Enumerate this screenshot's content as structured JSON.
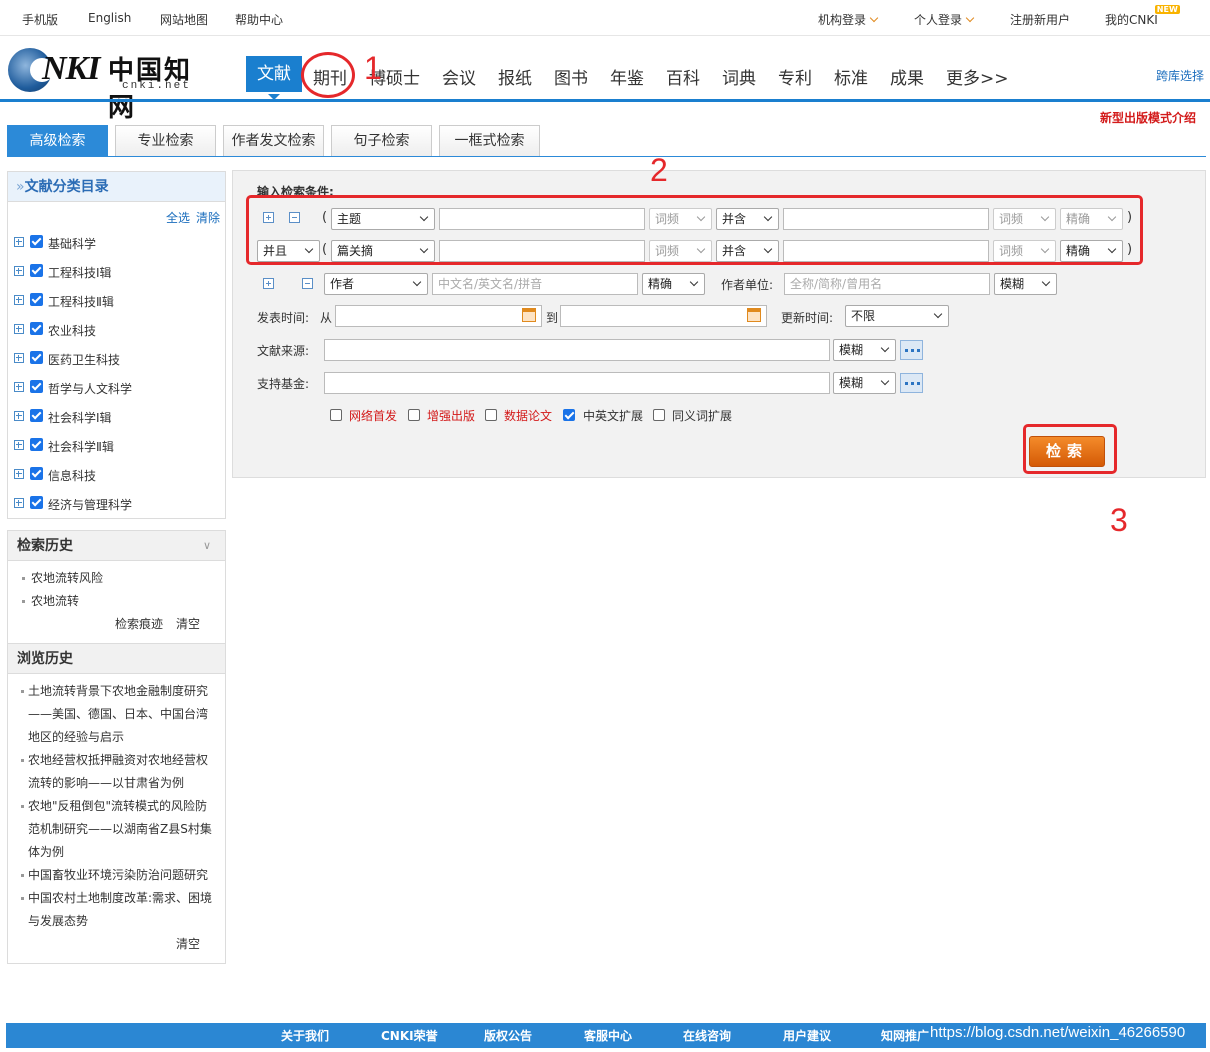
{
  "topbar": {
    "mobile": "手机版",
    "english": "English",
    "sitemap": "网站地图",
    "help": "帮助中心",
    "org_login": "机构登录",
    "personal_login": "个人登录",
    "register": "注册新用户",
    "my_cnki": "我的CNKI",
    "new_badge": "NEW"
  },
  "logo": {
    "brand": "CNKI",
    "nki": "NKI",
    "cn": "中国知网",
    "net": "cnki.net"
  },
  "nav": {
    "items": [
      "文献",
      "期刊",
      "博硕士",
      "会议",
      "报纸",
      "图书",
      "年鉴",
      "百科",
      "词典",
      "专利",
      "标准",
      "成果",
      "更多>>"
    ],
    "cross_select": "跨库选择",
    "new_mode": "新型出版模式介绍"
  },
  "tabs": [
    "高级检索",
    "专业检索",
    "作者发文检索",
    "句子检索",
    "一框式检索"
  ],
  "sidebar": {
    "catalog_title": "文献分类目录",
    "select_all": "全选",
    "clear": "清除",
    "categories": [
      "基础科学",
      "工程科技Ⅰ辑",
      "工程科技Ⅱ辑",
      "农业科技",
      "医药卫生科技",
      "哲学与人文科学",
      "社会科学Ⅰ辑",
      "社会科学Ⅱ辑",
      "信息科技",
      "经济与管理科学"
    ],
    "history_title": "检索历史",
    "history": [
      "农地流转风险",
      "农地流转"
    ],
    "history_trace": "检索痕迹",
    "history_clear": "清空",
    "browse_title": "浏览历史",
    "browse": [
      "土地流转背景下农地金融制度研究——美国、德国、日本、中国台湾地区的经验与启示",
      "农地经营权抵押融资对农地经营权流转的影响——以甘肃省为例",
      "农地\"反租倒包\"流转模式的风险防范机制研究——以湖南省Z县S村集体为例",
      "中国畜牧业环境污染防治问题研究",
      "中国农村土地制度改革:需求、困境与发展态势"
    ],
    "browse_clear": "清空"
  },
  "form": {
    "section_label": "输入检索条件:",
    "row1": {
      "field": "主题",
      "freq": "词频",
      "logic": "并含",
      "freq2": "词频",
      "match": "精确"
    },
    "row2": {
      "op": "并且",
      "field": "篇关摘",
      "freq": "词频",
      "logic": "并含",
      "freq2": "词频",
      "match": "精确"
    },
    "author_row": {
      "field": "作者",
      "placeholder": "中文名/英文名/拼音",
      "match": "精确",
      "org_label": "作者单位:",
      "org_placeholder": "全称/简称/曾用名",
      "org_match": "模糊"
    },
    "time_row": {
      "label": "发表时间:",
      "from": "从",
      "to": "到",
      "update_label": "更新时间:",
      "update_value": "不限"
    },
    "source_row": {
      "label": "文献来源:",
      "match": "模糊"
    },
    "fund_row": {
      "label": "支持基金:",
      "match": "模糊"
    },
    "checks": [
      {
        "label": "网络首发",
        "checked": false,
        "red": true
      },
      {
        "label": "增强出版",
        "checked": false,
        "red": true
      },
      {
        "label": "数据论文",
        "checked": false,
        "red": true
      },
      {
        "label": "中英文扩展",
        "checked": true,
        "red": false
      },
      {
        "label": "同义词扩展",
        "checked": false,
        "red": false
      }
    ],
    "search_button": "检索"
  },
  "annotations": {
    "n1": "1",
    "n2": "2",
    "n3": "3",
    "accent": "#e5282b"
  },
  "footer": {
    "links": [
      "关于我们",
      "CNKI荣誉",
      "版权公告",
      "客服中心",
      "在线咨询",
      "用户建议",
      "知网推广"
    ],
    "watermark": "https://blog.csdn.net/weixin_46266590"
  },
  "colors": {
    "primary": "#1a7fcf",
    "tab_active": "#2c8ad8",
    "search_button": "#e8741b"
  }
}
